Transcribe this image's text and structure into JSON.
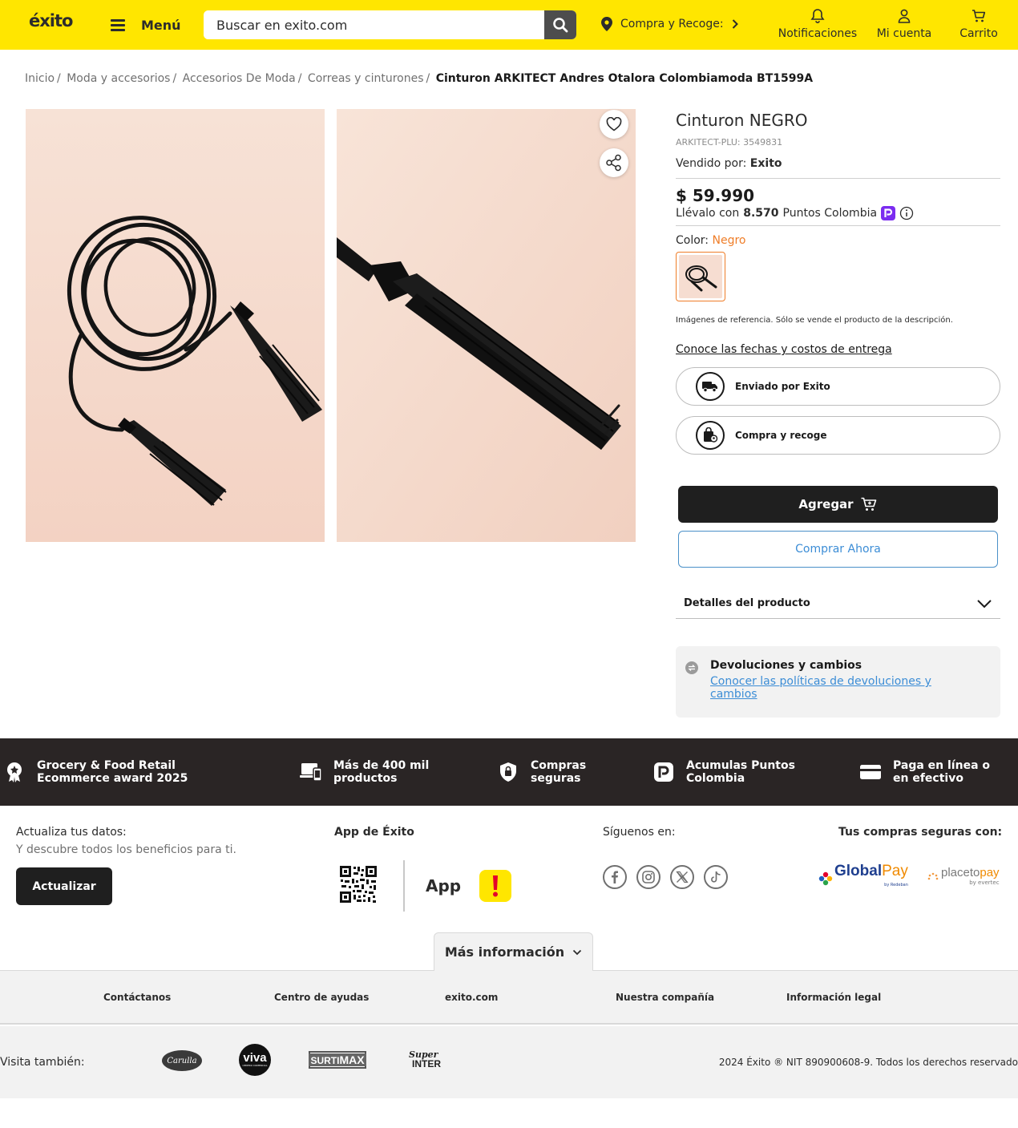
{
  "header": {
    "logo": "éxito",
    "menu_label": "Menú",
    "search_placeholder": "Buscar en exito.com",
    "pickup_label": "Compra y Recoge:",
    "notifications_label": "Notificaciones",
    "account_label": "Mi cuenta",
    "cart_label": "Carrito"
  },
  "breadcrumb": {
    "items": [
      "Inicio",
      "Moda y accesorios",
      "Accesorios De Moda",
      "Correas y cinturones"
    ],
    "current": "Cinturon ARKITECT Andres Otalora Colombiamoda BT1599A"
  },
  "product": {
    "title": "Cinturon NEGRO",
    "plu": "ARKITECT-PLU: 3549831",
    "seller_prefix": "Vendido por:",
    "seller_name": "Exito",
    "price": "$ 59.990",
    "points_prefix": "Llévalo con",
    "points_value": "8.570",
    "points_suffix": "Puntos Colombia",
    "color_label": "Color:",
    "color_value": "Negro",
    "disclaimer": "Imágenes de referencia. Sólo se vende el producto de la descripción.",
    "delivery_link": "Conoce las fechas y costos de entrega",
    "shipping_options": [
      "Enviado por Exito",
      "Compra y recoge"
    ],
    "add_button": "Agregar",
    "buy_now_button": "Comprar Ahora",
    "details_label": "Detalles del producto",
    "returns_title": "Devoluciones y cambios",
    "returns_link": "Conocer las políticas de devoluciones y cambios"
  },
  "benefits": [
    {
      "text": "Grocery & Food Retail Ecommerce award 2025",
      "icon": "award-icon"
    },
    {
      "text": "Más de 400 mil productos",
      "icon": "devices-icon"
    },
    {
      "text": "Compras seguras",
      "icon": "shield-lock-icon"
    },
    {
      "text": "Acumulas Puntos Colombia",
      "icon": "puntos-colombia-icon"
    },
    {
      "text": "Paga en línea o en efectivo",
      "icon": "card-icon"
    }
  ],
  "footer": {
    "update_title": "Actualiza tus datos:",
    "update_sub": "Y descubre todos los beneficios para ti.",
    "update_button": "Actualizar",
    "app_title": "App de Éxito",
    "app_label": "App",
    "social_title": "Síguenos en:",
    "social": [
      "facebook-icon",
      "instagram-icon",
      "x-icon",
      "tiktok-icon"
    ],
    "secure_title": "Tus compras seguras con:",
    "globalpay_a": "Global",
    "globalpay_b": "Pay",
    "globalpay_sub": "by Redeban",
    "placetopay_a": "placeto",
    "placetopay_b": "pay",
    "placetopay_sub": "by evertec",
    "more_info": "Más información",
    "links": [
      "Contáctanos",
      "Centro de ayudas",
      "exito.com",
      "Nuestra compañía",
      "Información legal"
    ],
    "visit_label": "Visita también:",
    "brands": [
      "Carulla",
      "viva",
      "SURTIMAX",
      "Super INTER"
    ],
    "brand_viva_sub": "CENTRO COMERCIAL",
    "brand_surtimax_a": "SURTI",
    "brand_surtimax_b": "MAX",
    "brand_superinter_a": "Super",
    "brand_superinter_b": "INTER",
    "copyright": "2024 Éxito ® NIT 890900608-9. Todos los derechos reservado"
  },
  "colors": {
    "brand_yellow": "#ffe600",
    "accent_orange": "#ef7d28",
    "link_blue": "#3c8dd6",
    "dark": "#1f1f1f",
    "band_dark": "#2a2525",
    "puntos_purple": "#7b2cf0"
  }
}
